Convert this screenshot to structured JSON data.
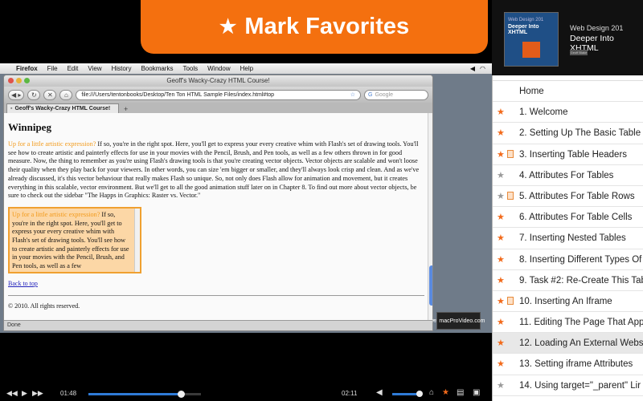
{
  "banner": {
    "star": "★",
    "text": "Mark Favorites"
  },
  "menubar": {
    "apple": "",
    "app": "Firefox",
    "items": [
      "File",
      "Edit",
      "View",
      "History",
      "Bookmarks",
      "Tools",
      "Window",
      "Help"
    ]
  },
  "browser": {
    "window_title": "Geoff's Wacky-Crazy HTML Course!",
    "url": "file:///Users/tentonbooks/Desktop/Ten Ton HTML Sample Files/index.html#top",
    "search_placeholder": "Google",
    "tab_label": "Geoff's Wacky-Crazy HTML Course!",
    "tab_add": "+",
    "status": "Done"
  },
  "page": {
    "heading": "Winnipeg",
    "lead": "Up for a little artistic expression?",
    "para": " If so, you're in the right spot. Here, you'll get to express your every creative whim with Flash's set of drawing tools. You'll see how to create artistic and painterly effects for use in your movies with the Pencil, Brush, and Pen tools, as well as a few others thrown in for good measure. Now, the thing to remember as you're using Flash's drawing tools is that you're creating vector objects. Vector objects are scalable and won't loose their quality when they play back for your viewers. In other words, you can size 'em bigger or smaller, and they'll always look crisp and clean. And as we've already discussed, it's this vector behaviour that really makes Flash so unique. So, not only does Flash allow for animation and movement, but it creates everything in this scalable, vector environment. But we'll get to all the good animation stuff later on in Chapter 8. To find out more about vector objects, be sure to check out the sidebar \"The Happs in Graphics: Raster vs. Vector.\"",
    "box_lead": "Up for a little artistic expression?",
    "box_text": " If so, you're in the right spot. Here, you'll get to express your every creative whim with Flash's set of drawing tools. You'll see how to create artistic and painterly effects for use in your movies with the Pencil, Brush, and Pen tools, as well as a few",
    "back_to_top": "Back to top",
    "copyright": "© 2010. All rights reserved."
  },
  "watermark": {
    "text": "macProVideo.com"
  },
  "player": {
    "current_time": "01:48",
    "end_time": "02:11",
    "progress": 0.82,
    "volume": 0.92
  },
  "course": {
    "series": "Web Design 201",
    "title": "Deeper Into XHTML",
    "cover_top": "Web Design 201",
    "cover_main": "Deeper Into XHTML",
    "author_badge": "Geoff Blake"
  },
  "lessons": [
    {
      "label": "Home",
      "star": "none",
      "note": false,
      "selected": false
    },
    {
      "label": "1. Welcome",
      "star": "orange",
      "note": false,
      "selected": false
    },
    {
      "label": "2. Setting Up The Basic Table",
      "star": "orange",
      "note": false,
      "selected": false
    },
    {
      "label": "3. Inserting Table Headers",
      "star": "orange",
      "note": true,
      "selected": false
    },
    {
      "label": "4. Attributes For Tables",
      "star": "gray",
      "note": false,
      "selected": false
    },
    {
      "label": "5. Attributes For Table Rows",
      "star": "gray",
      "note": true,
      "selected": false
    },
    {
      "label": "6. Attributes For Table Cells",
      "star": "orange",
      "note": false,
      "selected": false
    },
    {
      "label": "7. Inserting Nested Tables",
      "star": "orange",
      "note": false,
      "selected": false
    },
    {
      "label": "8. Inserting Different Types Of",
      "star": "orange",
      "note": false,
      "selected": false
    },
    {
      "label": "9. Task #2: Re-Create This Tab",
      "star": "orange",
      "note": false,
      "selected": false
    },
    {
      "label": "10. Inserting An Iframe",
      "star": "orange",
      "note": true,
      "selected": false
    },
    {
      "label": "11. Editing The Page That App",
      "star": "orange",
      "note": false,
      "selected": false
    },
    {
      "label": "12. Loading An External Webs",
      "star": "orange",
      "note": false,
      "selected": true
    },
    {
      "label": "13. Setting iframe Attributes",
      "star": "orange",
      "note": false,
      "selected": false
    },
    {
      "label": "14. Using target=\"_parent\" Lir",
      "star": "gray",
      "note": false,
      "selected": false
    }
  ],
  "colors": {
    "accent": "#f4700f",
    "star_orange": "#f26a1b",
    "star_gray": "#9a9a9a",
    "progress": "#2f7bd6"
  }
}
